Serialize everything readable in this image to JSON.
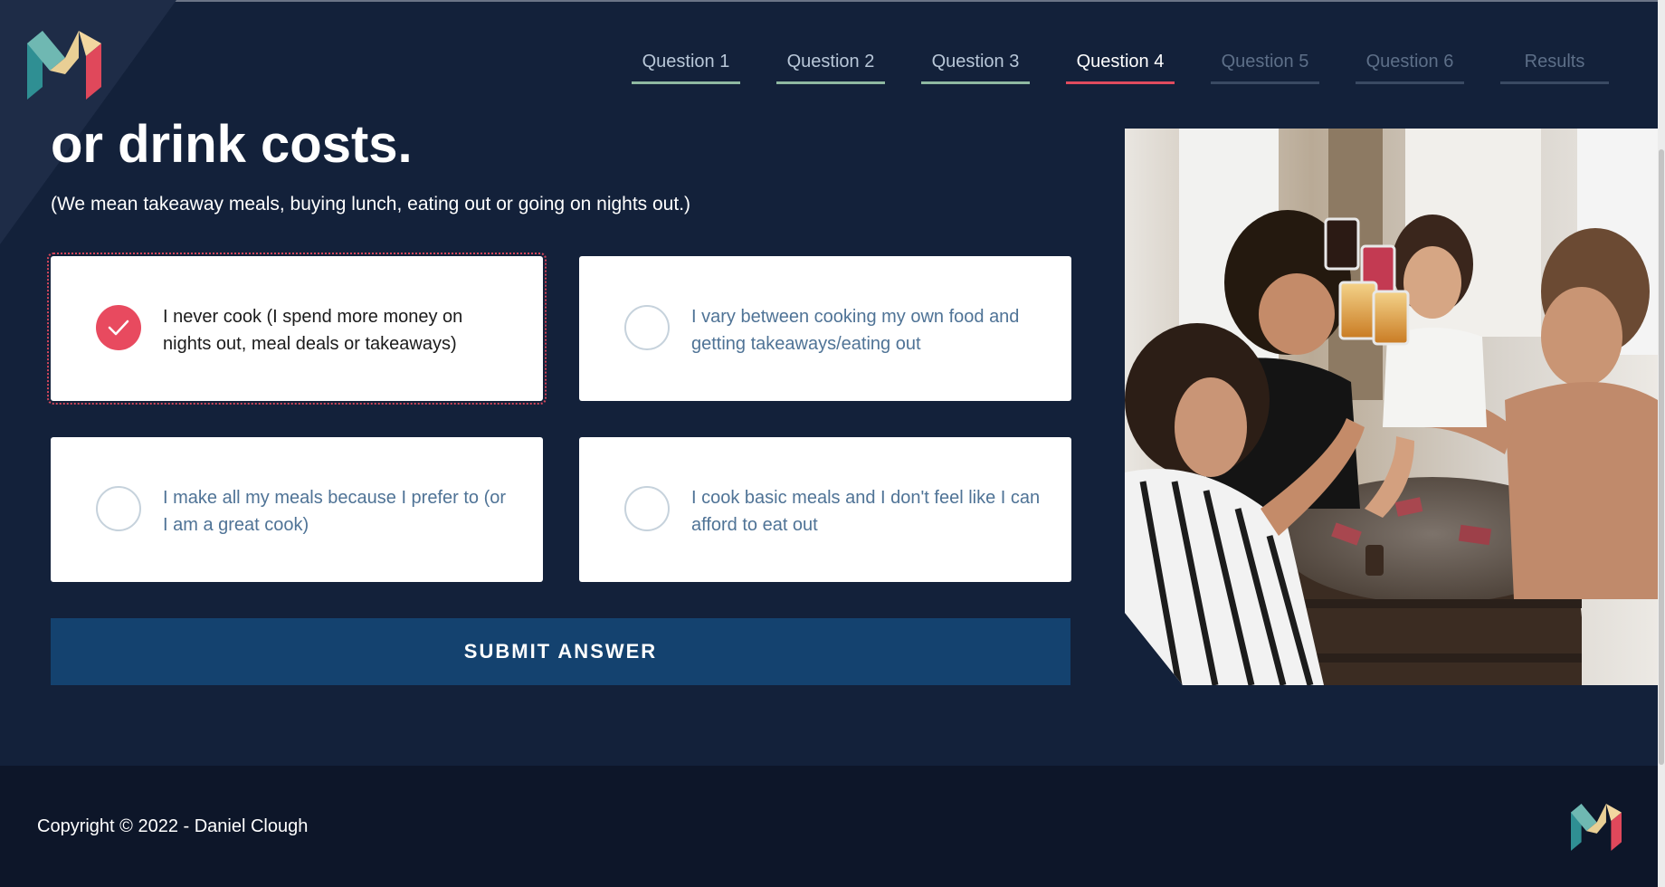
{
  "nav": {
    "tabs": [
      {
        "label": "Question 1",
        "state": "done"
      },
      {
        "label": "Question 2",
        "state": "done"
      },
      {
        "label": "Question 3",
        "state": "done"
      },
      {
        "label": "Question 4",
        "state": "active"
      },
      {
        "label": "Question 5",
        "state": "future"
      },
      {
        "label": "Question 6",
        "state": "future"
      },
      {
        "label": "Results",
        "state": "future"
      }
    ]
  },
  "question": {
    "heading": "or drink costs.",
    "subtext": "(We mean takeaway meals, buying lunch, eating out or going on nights out.)"
  },
  "options": [
    {
      "label": "I never cook (I spend more money on nights out, meal deals or takeaways)",
      "selected": true
    },
    {
      "label": "I vary between cooking my own food and getting takeaways/eating out",
      "selected": false
    },
    {
      "label": "I make all my meals because I prefer to (or I am a great cook)",
      "selected": false
    },
    {
      "label": "I cook basic meals and I don't feel like I can afford to eat out",
      "selected": false
    }
  ],
  "submit_label": "SUBMIT ANSWER",
  "footer": {
    "copyright": "Copyright © 2022 - Daniel Clough"
  },
  "colors": {
    "background": "#13213a",
    "footer": "#0d1629",
    "accent": "#e84a5f",
    "completed": "#8fb8a1",
    "submit": "#14426f"
  },
  "icons": {
    "logo": "monzo-m-logo-icon",
    "check": "checkmark-icon"
  }
}
